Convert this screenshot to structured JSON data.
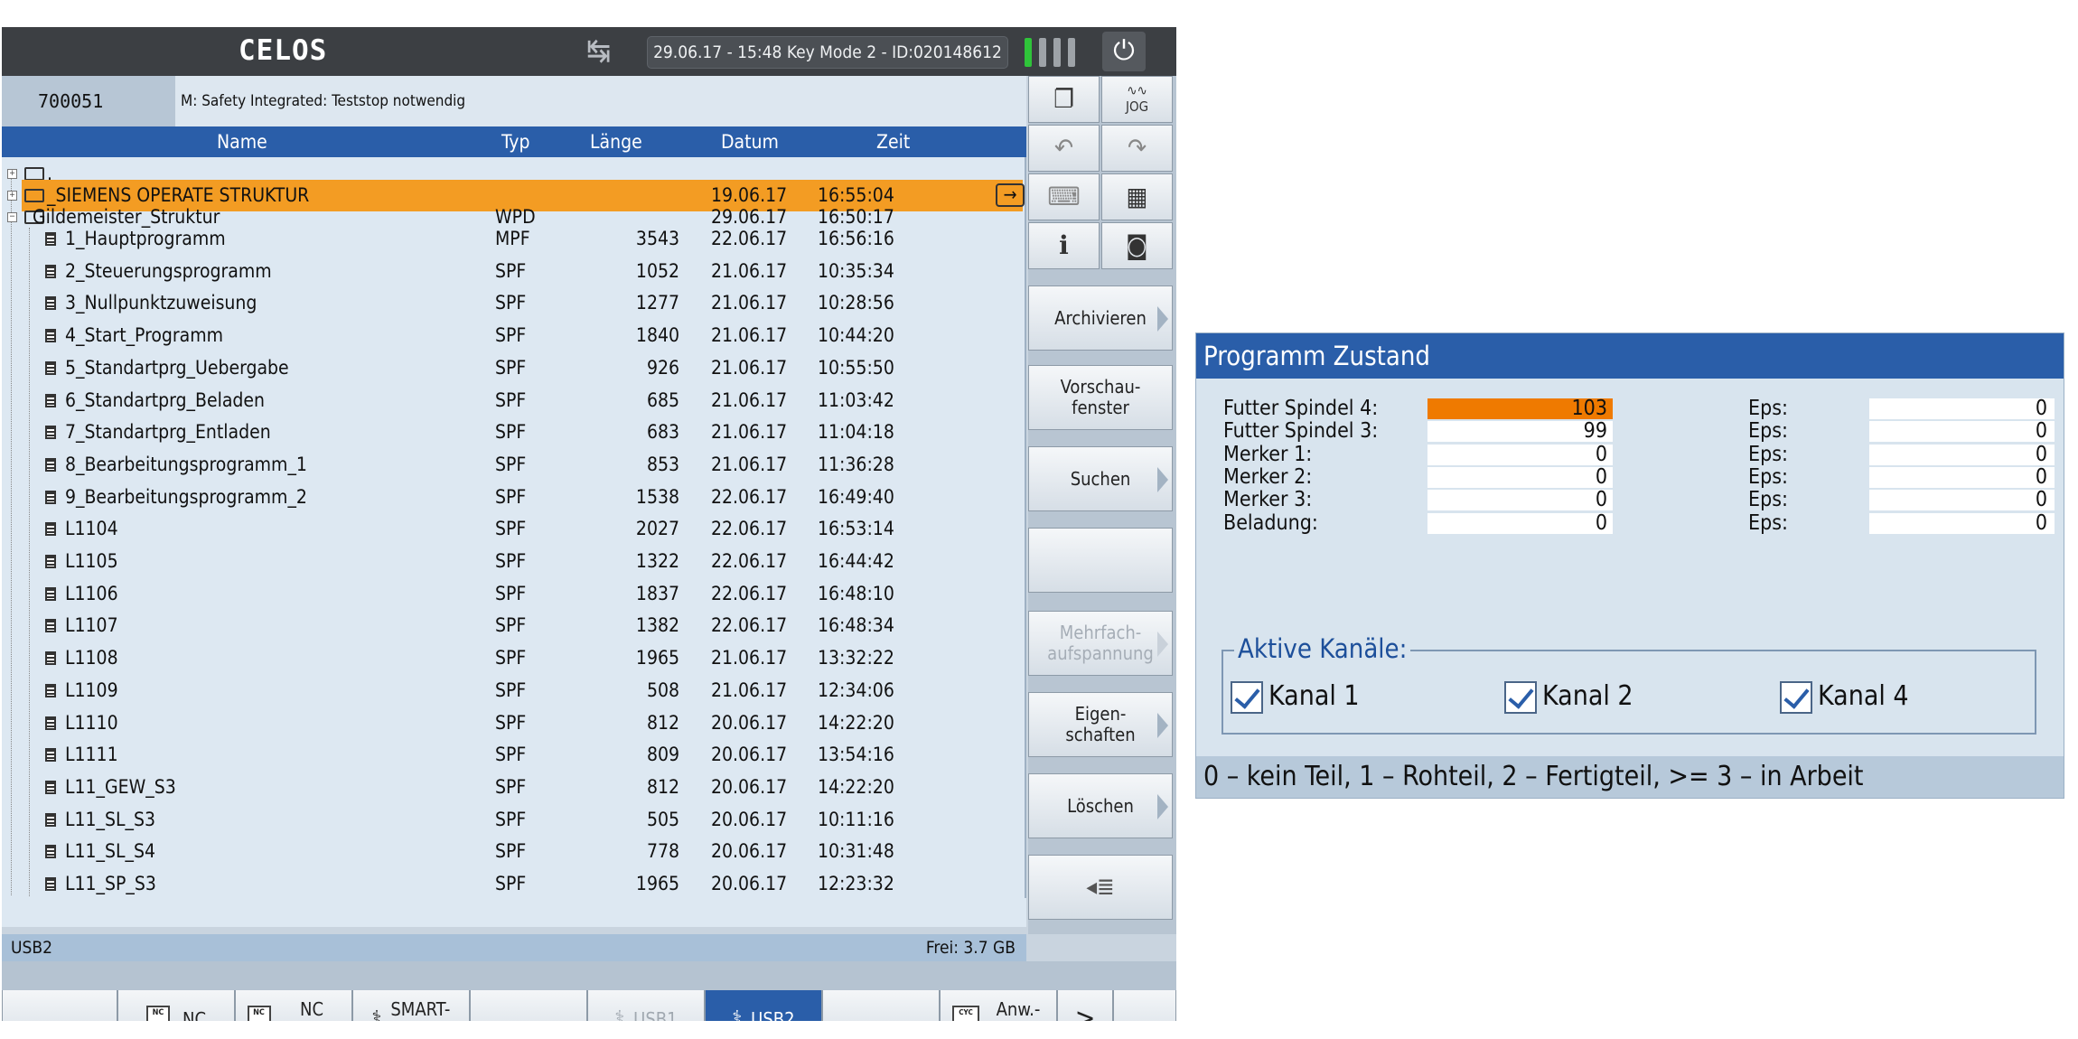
{
  "header": {
    "logo": "CELOS",
    "status": "29.06.17 - 15:48  Key Mode 2 - ID:020148612",
    "swap_icon": "↹",
    "power_icon": "⏻"
  },
  "alarm": {
    "code": "700051",
    "text": "M: Safety Integrated: Teststop notwendig"
  },
  "filelist": {
    "columns": {
      "name": "Name",
      "typ": "Typ",
      "laenge": "Länge",
      "datum": "Datum",
      "zeit": "Zeit"
    },
    "root_label": ".",
    "selected": {
      "name": "_SIEMENS OPERATE STRUKTUR",
      "datum": "19.06.17",
      "zeit": "16:55:04"
    },
    "folder": {
      "name": "Gildemeister_Struktur",
      "typ": "WPD",
      "datum": "29.06.17",
      "zeit": "16:50:17"
    },
    "files": [
      {
        "name": "1_Hauptprogramm",
        "typ": "MPF",
        "laenge": "3543",
        "datum": "22.06.17",
        "zeit": "16:56:16"
      },
      {
        "name": "2_Steuerungsprogramm",
        "typ": "SPF",
        "laenge": "1052",
        "datum": "21.06.17",
        "zeit": "10:35:34"
      },
      {
        "name": "3_Nullpunktzuweisung",
        "typ": "SPF",
        "laenge": "1277",
        "datum": "21.06.17",
        "zeit": "10:28:56"
      },
      {
        "name": "4_Start_Programm",
        "typ": "SPF",
        "laenge": "1840",
        "datum": "21.06.17",
        "zeit": "10:44:20"
      },
      {
        "name": "5_Standartprg_Uebergabe",
        "typ": "SPF",
        "laenge": "926",
        "datum": "21.06.17",
        "zeit": "10:55:50"
      },
      {
        "name": "6_Standartprg_Beladen",
        "typ": "SPF",
        "laenge": "685",
        "datum": "21.06.17",
        "zeit": "11:03:42"
      },
      {
        "name": "7_Standartprg_Entladen",
        "typ": "SPF",
        "laenge": "683",
        "datum": "21.06.17",
        "zeit": "11:04:18"
      },
      {
        "name": "8_Bearbeitungsprogramm_1",
        "typ": "SPF",
        "laenge": "853",
        "datum": "21.06.17",
        "zeit": "11:36:28"
      },
      {
        "name": "9_Bearbeitungsprogramm_2",
        "typ": "SPF",
        "laenge": "1538",
        "datum": "22.06.17",
        "zeit": "16:49:40"
      },
      {
        "name": "L1104",
        "typ": "SPF",
        "laenge": "2027",
        "datum": "22.06.17",
        "zeit": "16:53:14"
      },
      {
        "name": "L1105",
        "typ": "SPF",
        "laenge": "1322",
        "datum": "22.06.17",
        "zeit": "16:44:42"
      },
      {
        "name": "L1106",
        "typ": "SPF",
        "laenge": "1837",
        "datum": "22.06.17",
        "zeit": "16:48:10"
      },
      {
        "name": "L1107",
        "typ": "SPF",
        "laenge": "1382",
        "datum": "22.06.17",
        "zeit": "16:48:34"
      },
      {
        "name": "L1108",
        "typ": "SPF",
        "laenge": "1965",
        "datum": "21.06.17",
        "zeit": "13:32:22"
      },
      {
        "name": "L1109",
        "typ": "SPF",
        "laenge": "508",
        "datum": "21.06.17",
        "zeit": "12:34:06"
      },
      {
        "name": "L1110",
        "typ": "SPF",
        "laenge": "812",
        "datum": "20.06.17",
        "zeit": "14:22:20"
      },
      {
        "name": "L1111",
        "typ": "SPF",
        "laenge": "809",
        "datum": "20.06.17",
        "zeit": "13:54:16"
      },
      {
        "name": "L11_GEW_S3",
        "typ": "SPF",
        "laenge": "812",
        "datum": "20.06.17",
        "zeit": "14:22:20"
      },
      {
        "name": "L11_SL_S3",
        "typ": "SPF",
        "laenge": "505",
        "datum": "20.06.17",
        "zeit": "10:11:16"
      },
      {
        "name": "L11_SL_S4",
        "typ": "SPF",
        "laenge": "778",
        "datum": "20.06.17",
        "zeit": "10:31:48"
      },
      {
        "name": "L11_SP_S3",
        "typ": "SPF",
        "laenge": "1965",
        "datum": "20.06.17",
        "zeit": "12:23:32"
      }
    ],
    "status_drive": "USB2",
    "status_free": "Frei: 3.7 GB"
  },
  "right_keys": {
    "jog_label": "JOG",
    "info_label": "i",
    "softkeys": [
      "Archivieren",
      "Vorschau-\nfenster",
      "Suchen",
      "",
      "Mehrfach-\naufspannung",
      "Eigen-\nschaften",
      "Löschen"
    ]
  },
  "bottom_keys": {
    "nc": "NC",
    "nc_extend": "NC\nExtend",
    "smart_key": "SMART-\nKEY",
    "usb1": "USB1",
    "usb2": "USB2",
    "anw_zyklen": "Anw.-\nzyklen",
    "more": ">"
  },
  "programm_zustand": {
    "title": "Programm Zustand",
    "rows": [
      {
        "label": "Futter Spindel 4:",
        "value": "103",
        "eps_label": "Eps:",
        "eps": "0"
      },
      {
        "label": "Futter Spindel 3:",
        "value": "99",
        "eps_label": "Eps:",
        "eps": "0"
      },
      {
        "label": "Merker 1:",
        "value": "0",
        "eps_label": "Eps:",
        "eps": "0"
      },
      {
        "label": "Merker 2:",
        "value": "0",
        "eps_label": "Eps:",
        "eps": "0"
      },
      {
        "label": "Merker 3:",
        "value": "0",
        "eps_label": "Eps:",
        "eps": "0"
      },
      {
        "label": "Beladung:",
        "value": "0",
        "eps_label": "Eps:",
        "eps": "0"
      }
    ],
    "kanal_legend": "Aktive Kanäle:",
    "kanaele": [
      "Kanal 1",
      "Kanal 2",
      "Kanal 4"
    ],
    "footer": "0 – kein Teil, 1 – Rohteil, 2 – Fertigteil, >= 3 – in Arbeit"
  },
  "colors": {
    "accent": "#2a5ea9",
    "selection": "#f39c23",
    "highlight": "#ef7a00"
  }
}
